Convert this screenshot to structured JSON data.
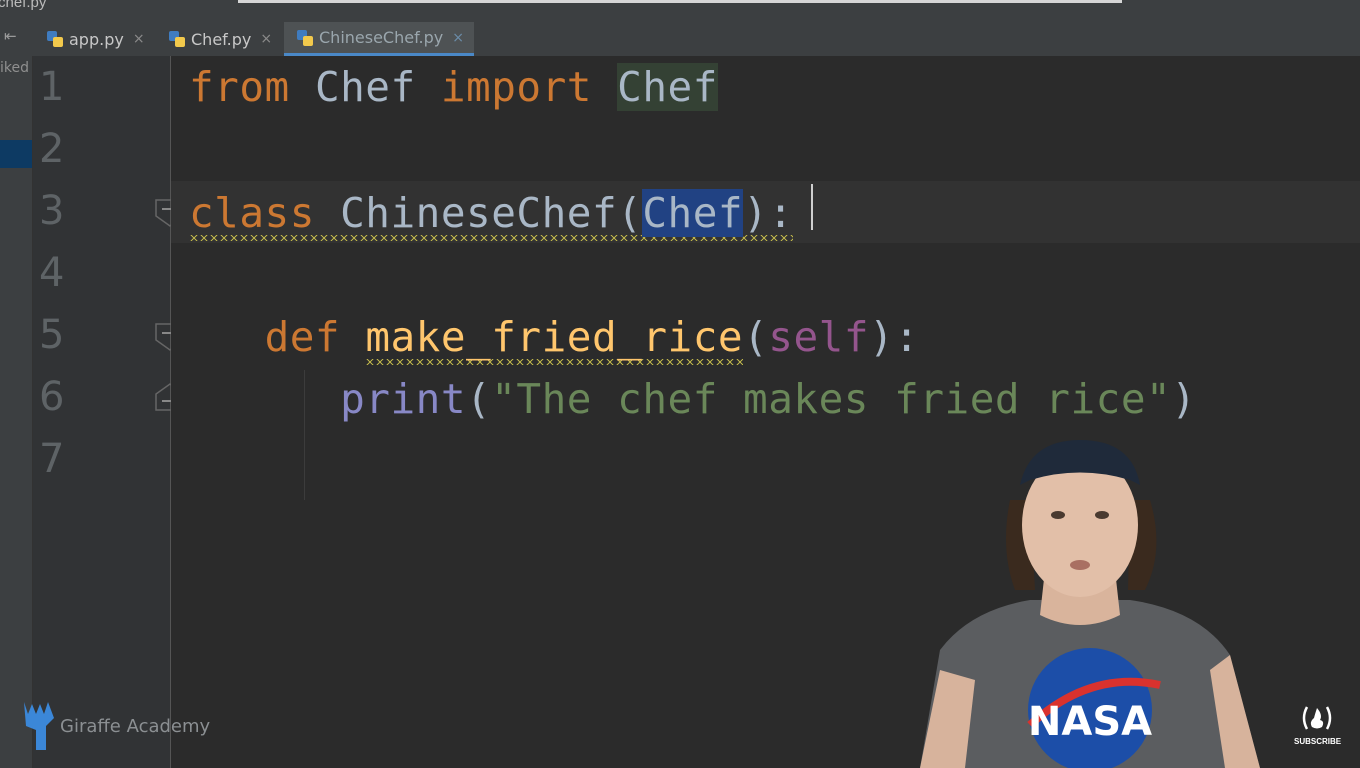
{
  "window": {
    "file_crumb": "chef.py"
  },
  "tabs": [
    {
      "label": "app.py",
      "close": "×",
      "active": false
    },
    {
      "label": "Chef.py",
      "close": "×",
      "active": false
    },
    {
      "label": "ChineseChef.py",
      "close": "×",
      "active": true
    }
  ],
  "left_strip": {
    "label": "iked"
  },
  "gutter": {
    "line_numbers": [
      "1",
      "2",
      "3",
      "4",
      "5",
      "6",
      "7"
    ]
  },
  "code": {
    "line1": {
      "kw_from": "from",
      "module": "Chef",
      "kw_import": "import",
      "name": "Chef"
    },
    "line3": {
      "kw_class": "class",
      "class_name": "ChineseChef",
      "open": "(",
      "base": "Chef",
      "close": "):"
    },
    "line5": {
      "kw_def": "def",
      "fn_name": "make_fried_rice",
      "open": "(",
      "param": "self",
      "close": "):"
    },
    "line6": {
      "fn": "print",
      "open": "(",
      "string": "\"The chef makes fried rice\"",
      "close": ")"
    }
  },
  "watermark": {
    "text": "Giraffe Academy"
  },
  "subscribe": {
    "label": "SUBSCRIBE"
  },
  "colors": {
    "keyword": "#cc7832",
    "string": "#6a8759",
    "self": "#94558d",
    "builtin": "#8888c6",
    "function": "#ffc66d",
    "default": "#a9b7c6",
    "selection": "#214283",
    "active_tab_underline": "#4a88c7"
  }
}
